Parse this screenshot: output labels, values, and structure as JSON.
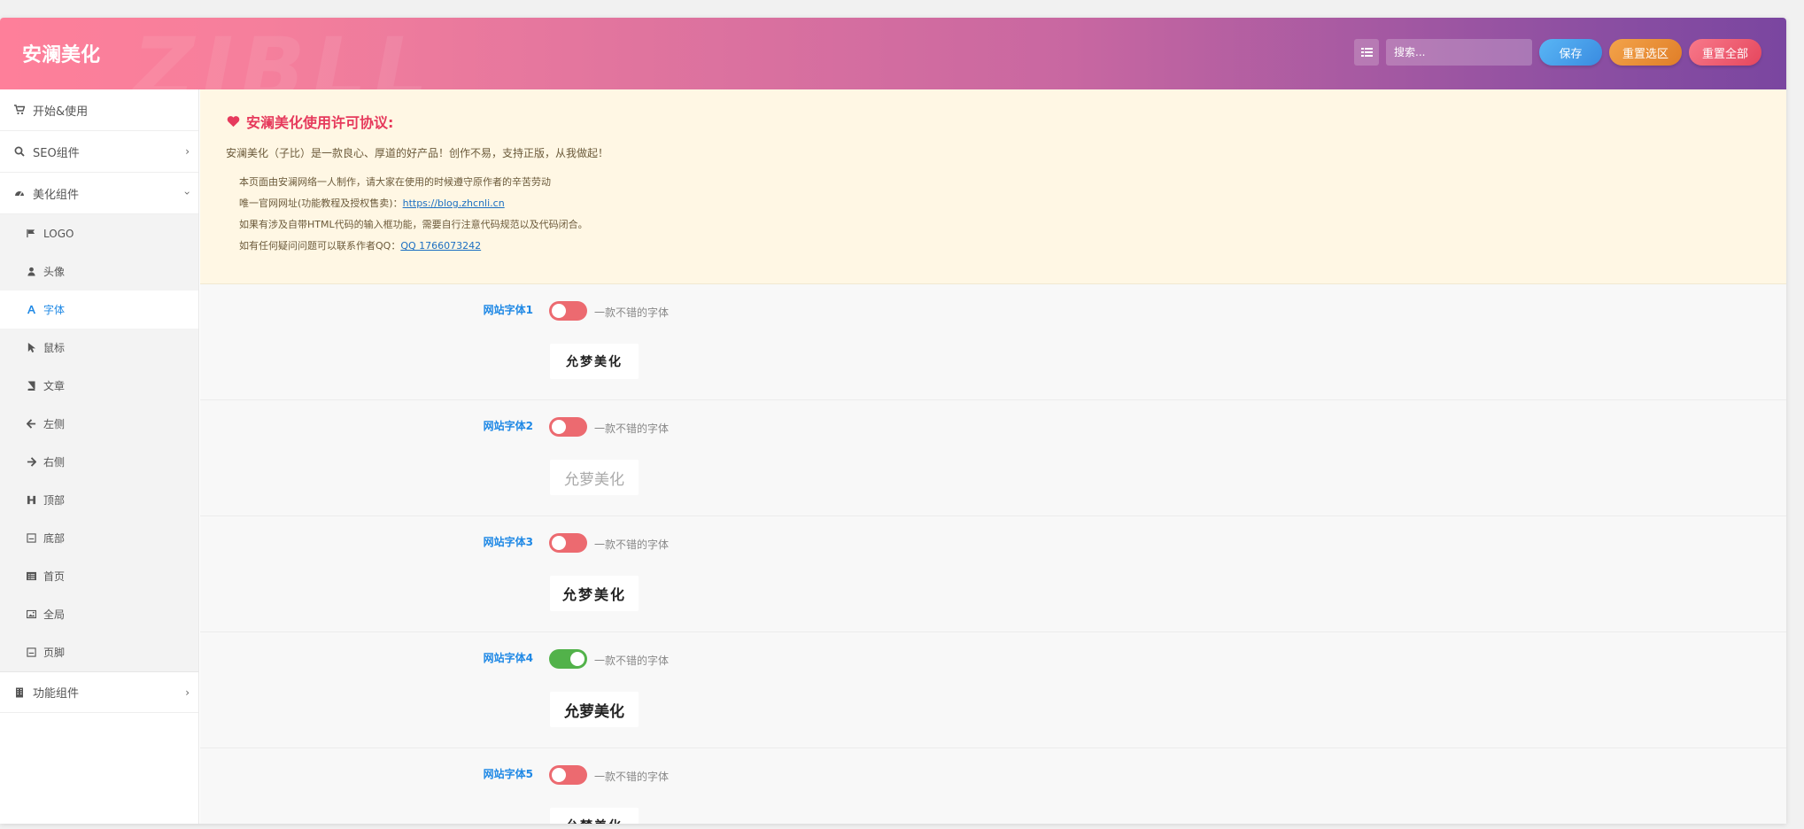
{
  "header": {
    "brand": "安澜美化",
    "watermark": "ZIBLL",
    "search_placeholder": "搜索...",
    "save_label": "保存",
    "reset_section_label": "重置选区",
    "reset_all_label": "重置全部"
  },
  "sidebar": {
    "items": [
      {
        "label": "开始&使用",
        "icon": "cart-icon"
      },
      {
        "label": "SEO组件",
        "icon": "search-icon"
      },
      {
        "label": "美化组件",
        "icon": "dashboard-icon"
      },
      {
        "label": "功能组件",
        "icon": "building-icon"
      }
    ],
    "sub_items": [
      {
        "label": "LOGO",
        "icon": "flag-icon"
      },
      {
        "label": "头像",
        "icon": "user-icon"
      },
      {
        "label": "字体",
        "icon": "font-icon"
      },
      {
        "label": "鼠标",
        "icon": "cursor-icon"
      },
      {
        "label": "文章",
        "icon": "book-icon"
      },
      {
        "label": "左侧",
        "icon": "arrow-left-icon"
      },
      {
        "label": "右侧",
        "icon": "arrow-right-icon"
      },
      {
        "label": "顶部",
        "icon": "header-icon"
      },
      {
        "label": "底部",
        "icon": "footer-icon"
      },
      {
        "label": "首页",
        "icon": "list-icon"
      },
      {
        "label": "全局",
        "icon": "image-icon"
      },
      {
        "label": "页脚",
        "icon": "footer-icon"
      }
    ]
  },
  "notice": {
    "title": "安澜美化使用许可协议:",
    "lead": "安澜美化（子比）是一款良心、厚道的好产品！创作不易，支持正版，从我做起！",
    "line1": "本页面由安澜网络一人制作，请大家在使用的时候遵守原作者的辛苦劳动",
    "line2_prefix": "唯一官网网址(功能教程及授权售卖)：",
    "line2_link": "https://blog.zhcnli.cn",
    "line3": "如果有涉及自带HTML代码的输入框功能，需要自行注意代码规范以及代码闭合。",
    "line4_prefix": "如有任何疑问问题可以联系作者QQ：",
    "line4_link": "QQ 1766073242"
  },
  "fonts": [
    {
      "label": "网站字体1",
      "desc": "一款不错的字体",
      "on": false,
      "preview": "允梦美化"
    },
    {
      "label": "网站字体2",
      "desc": "一款不错的字体",
      "on": false,
      "preview": "允萝美化"
    },
    {
      "label": "网站字体3",
      "desc": "一款不错的字体",
      "on": false,
      "preview": "允梦美化"
    },
    {
      "label": "网站字体4",
      "desc": "一款不错的字体",
      "on": true,
      "preview": "允萝美化"
    },
    {
      "label": "网站字体5",
      "desc": "一款不错的字体",
      "on": false,
      "preview": "允梦美化"
    }
  ],
  "colors": {
    "accent_blue": "#1e88e5",
    "switch_off": "#ec6a70",
    "switch_on": "#52b24a",
    "notice_bg": "#fff7e4"
  }
}
